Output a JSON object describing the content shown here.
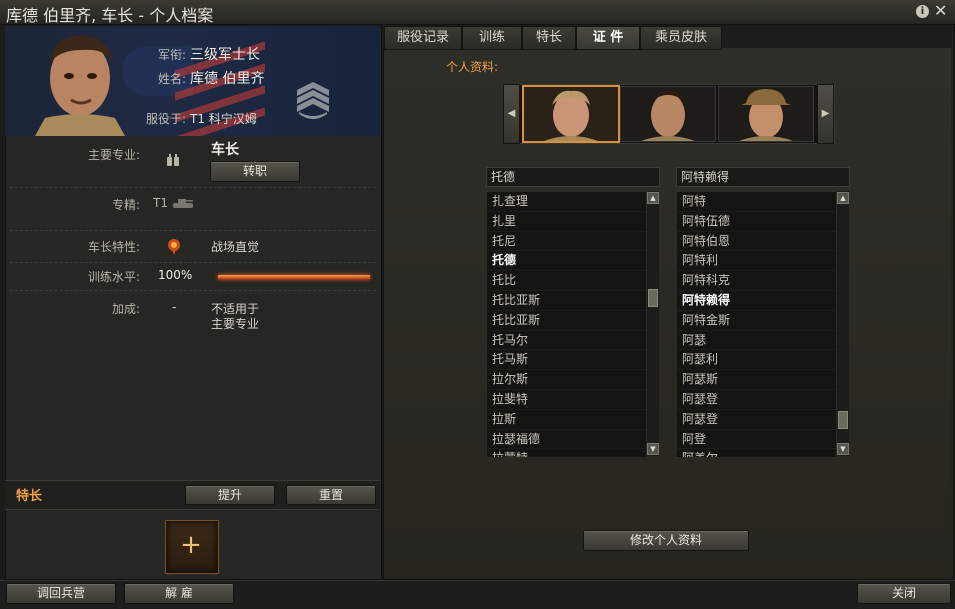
{
  "window": {
    "title": "库德 伯里齐, 车长 - 个人档案",
    "help_icon": "info-icon",
    "close_icon": "close-icon"
  },
  "profile": {
    "rank_label": "军衔:",
    "rank_value": "三级军士长",
    "name_label": "姓名:",
    "name_value": "库德 伯里齐",
    "service_label": "服役于:",
    "service_value": "T1 科宁汉姆"
  },
  "fields": {
    "primary_label": "主要专业:",
    "primary_value": "车长",
    "retrain_button": "转职",
    "mastery_label": "专精:",
    "mastery_value": "T1",
    "trait_label": "车长特性:",
    "trait_value": "战场直觉",
    "training_label": "训练水平:",
    "training_value": "100%",
    "training_level": 1.0,
    "bonus_label": "加成:",
    "bonus_value": "-",
    "bonus_note_line1": "不适用于",
    "bonus_note_line2": "主要专业"
  },
  "skills": {
    "title": "特长",
    "upgrade_button": "提升",
    "reset_button": "重置",
    "add_icon": "plus-icon"
  },
  "tabs": [
    {
      "label": "服役记录",
      "active": false
    },
    {
      "label": "训练",
      "active": false
    },
    {
      "label": "特长",
      "active": false
    },
    {
      "label": "证 件",
      "active": true
    },
    {
      "label": "乘员皮肤",
      "active": false
    }
  ],
  "documents": {
    "section_title": "个人资料:",
    "first_name_selected": "托德",
    "last_name_selected": "阿特赖得",
    "first_names": [
      "扎查理",
      "扎里",
      "托尼",
      "托德",
      "托比",
      "托比亚斯",
      "托比亚斯",
      "托马尔",
      "托马斯",
      "拉尔斯",
      "拉斐特",
      "拉斯",
      "拉瑟福德",
      "拉蒙特"
    ],
    "first_selected_index": 3,
    "last_names": [
      "阿特",
      "阿特伍德",
      "阿特伯恩",
      "阿特利",
      "阿特科克",
      "阿特赖得",
      "阿特金斯",
      "阿瑟",
      "阿瑟利",
      "阿瑟斯",
      "阿瑟登",
      "阿瑟登",
      "阿登",
      "阿盖尔"
    ],
    "last_selected_index": 5,
    "edit_button": "修改个人资料"
  },
  "bottom": {
    "return_button": "调回兵营",
    "dismiss_button": "解 雇",
    "close_button": "关闭"
  },
  "colors": {
    "accent_orange": "#f0a040",
    "selection_border": "#d8903a"
  }
}
